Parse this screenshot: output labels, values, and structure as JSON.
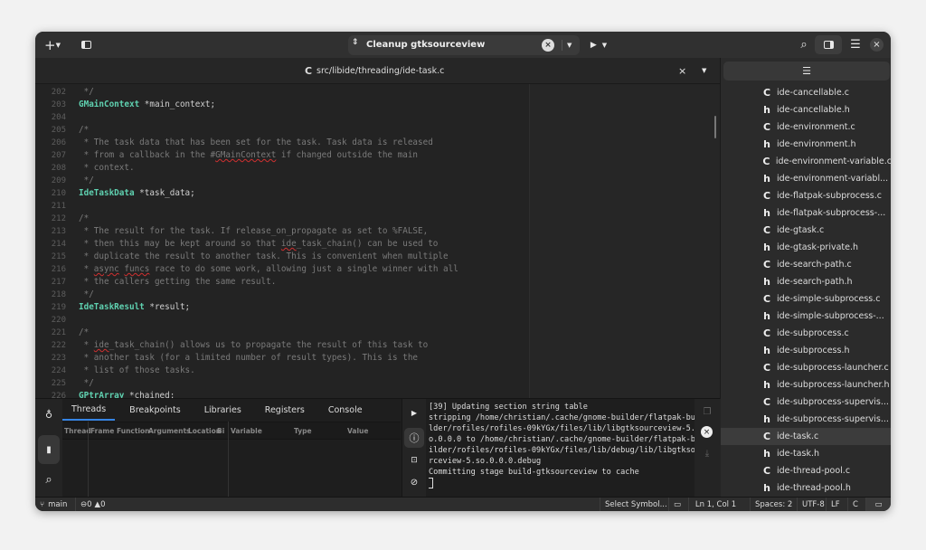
{
  "header": {
    "target": "Cleanup gtksourceview",
    "icons": [
      "plus-icon",
      "sidebar-icon",
      "stop-icon",
      "run-icon",
      "search-icon",
      "panel-icon",
      "menu-icon",
      "close-icon"
    ]
  },
  "tab": {
    "icon": "C",
    "path": "src/libide/threading/ide-task.c"
  },
  "editor": {
    "lines": [
      {
        "n": "202",
        "html": "<span class=\"cm\"> */</span>"
      },
      {
        "n": "203",
        "html": "<span class=\"ty\">GMainContext</span> *main_context;"
      },
      {
        "n": "204",
        "html": ""
      },
      {
        "n": "205",
        "html": "<span class=\"cm\">/*</span>"
      },
      {
        "n": "206",
        "html": "<span class=\"cm\"> * The task data that has been set for the task. Task data is released</span>"
      },
      {
        "n": "207",
        "html": "<span class=\"cm\"> * from a callback in the #<span class=\"sq\">GMainContext</span> if changed outside the main</span>"
      },
      {
        "n": "208",
        "html": "<span class=\"cm\"> * context.</span>"
      },
      {
        "n": "209",
        "html": "<span class=\"cm\"> */</span>"
      },
      {
        "n": "210",
        "html": "<span class=\"ty\">IdeTaskData</span> *task_data;"
      },
      {
        "n": "211",
        "html": ""
      },
      {
        "n": "212",
        "html": "<span class=\"cm\">/*</span>"
      },
      {
        "n": "213",
        "html": "<span class=\"cm\"> * The result for the task. If release_on_propagate as set to %FALSE,</span>"
      },
      {
        "n": "214",
        "html": "<span class=\"cm\"> * then this may be kept around so that <span class=\"sq\">ide</span>_task_chain() can be used to</span>"
      },
      {
        "n": "215",
        "html": "<span class=\"cm\"> * duplicate the result to another task. This is convenient when multiple</span>"
      },
      {
        "n": "216",
        "html": "<span class=\"cm\"> * <span class=\"sq\">async</span> <span class=\"sq\">funcs</span> race to do some work, allowing just a single winner with all</span>"
      },
      {
        "n": "217",
        "html": "<span class=\"cm\"> * the callers getting the same result.</span>"
      },
      {
        "n": "218",
        "html": "<span class=\"cm\"> */</span>"
      },
      {
        "n": "219",
        "html": "<span class=\"ty\">IdeTaskResult</span> *result;"
      },
      {
        "n": "220",
        "html": ""
      },
      {
        "n": "221",
        "html": "<span class=\"cm\">/*</span>"
      },
      {
        "n": "222",
        "html": "<span class=\"cm\"> * <span class=\"sq\">ide</span>_task_chain() allows us to propagate the result of this task to</span>"
      },
      {
        "n": "223",
        "html": "<span class=\"cm\"> * another task (for a limited number of result types). This is the</span>"
      },
      {
        "n": "224",
        "html": "<span class=\"cm\"> * list of those tasks.</span>"
      },
      {
        "n": "225",
        "html": "<span class=\"cm\"> */</span>"
      },
      {
        "n": "226",
        "html": "<span class=\"ty\">GPtrArray</span> *chained;"
      }
    ]
  },
  "sidebar": {
    "files": [
      {
        "icon": "C",
        "name": "ide-cancellable.c"
      },
      {
        "icon": "h",
        "name": "ide-cancellable.h"
      },
      {
        "icon": "C",
        "name": "ide-environment.c"
      },
      {
        "icon": "h",
        "name": "ide-environment.h"
      },
      {
        "icon": "C",
        "name": "ide-environment-variable.c"
      },
      {
        "icon": "h",
        "name": "ide-environment-variabl..."
      },
      {
        "icon": "C",
        "name": "ide-flatpak-subprocess.c"
      },
      {
        "icon": "h",
        "name": "ide-flatpak-subprocess-..."
      },
      {
        "icon": "C",
        "name": "ide-gtask.c"
      },
      {
        "icon": "h",
        "name": "ide-gtask-private.h"
      },
      {
        "icon": "C",
        "name": "ide-search-path.c"
      },
      {
        "icon": "h",
        "name": "ide-search-path.h"
      },
      {
        "icon": "C",
        "name": "ide-simple-subprocess.c"
      },
      {
        "icon": "h",
        "name": "ide-simple-subprocess-..."
      },
      {
        "icon": "C",
        "name": "ide-subprocess.c"
      },
      {
        "icon": "h",
        "name": "ide-subprocess.h"
      },
      {
        "icon": "C",
        "name": "ide-subprocess-launcher.c"
      },
      {
        "icon": "h",
        "name": "ide-subprocess-launcher.h"
      },
      {
        "icon": "C",
        "name": "ide-subprocess-supervis..."
      },
      {
        "icon": "h",
        "name": "ide-subprocess-supervis..."
      },
      {
        "icon": "C",
        "name": "ide-task.c",
        "selected": true
      },
      {
        "icon": "h",
        "name": "ide-task.h"
      },
      {
        "icon": "C",
        "name": "ide-thread-pool.c"
      },
      {
        "icon": "h",
        "name": "ide-thread-pool.h"
      }
    ]
  },
  "panel": {
    "tabs": [
      "Threads",
      "Breakpoints",
      "Libraries",
      "Registers",
      "Console"
    ],
    "columns": [
      "Thread",
      "Frame",
      "Function",
      "Arguments",
      "Location",
      "Bi",
      "Variable",
      "Type",
      "Value"
    ],
    "console": "[39] Updating section string table\nstripping /home/christian/.cache/gnome-builder/flatpak-bui\nlder/rofiles/rofiles-09kYGx/files/lib/libgtksourceview-5.s\no.0.0.0 to /home/christian/.cache/gnome-builder/flatpak-bu\nilder/rofiles/rofiles-09kYGx/files/lib/debug/lib/libgtksou\nrceview-5.so.0.0.0.debug\nCommitting stage build-gtksourceview to cache"
  },
  "status": {
    "branch": "main",
    "errors": "0",
    "warnings": "0",
    "symbol": "Select Symbol...",
    "position": "Ln 1, Col 1",
    "spaces": "Spaces: 2",
    "encoding": "UTF-8",
    "eol": "LF",
    "lang": "C"
  },
  "colors": {
    "accent": "#3584e4",
    "type": "#5fd1b0"
  }
}
